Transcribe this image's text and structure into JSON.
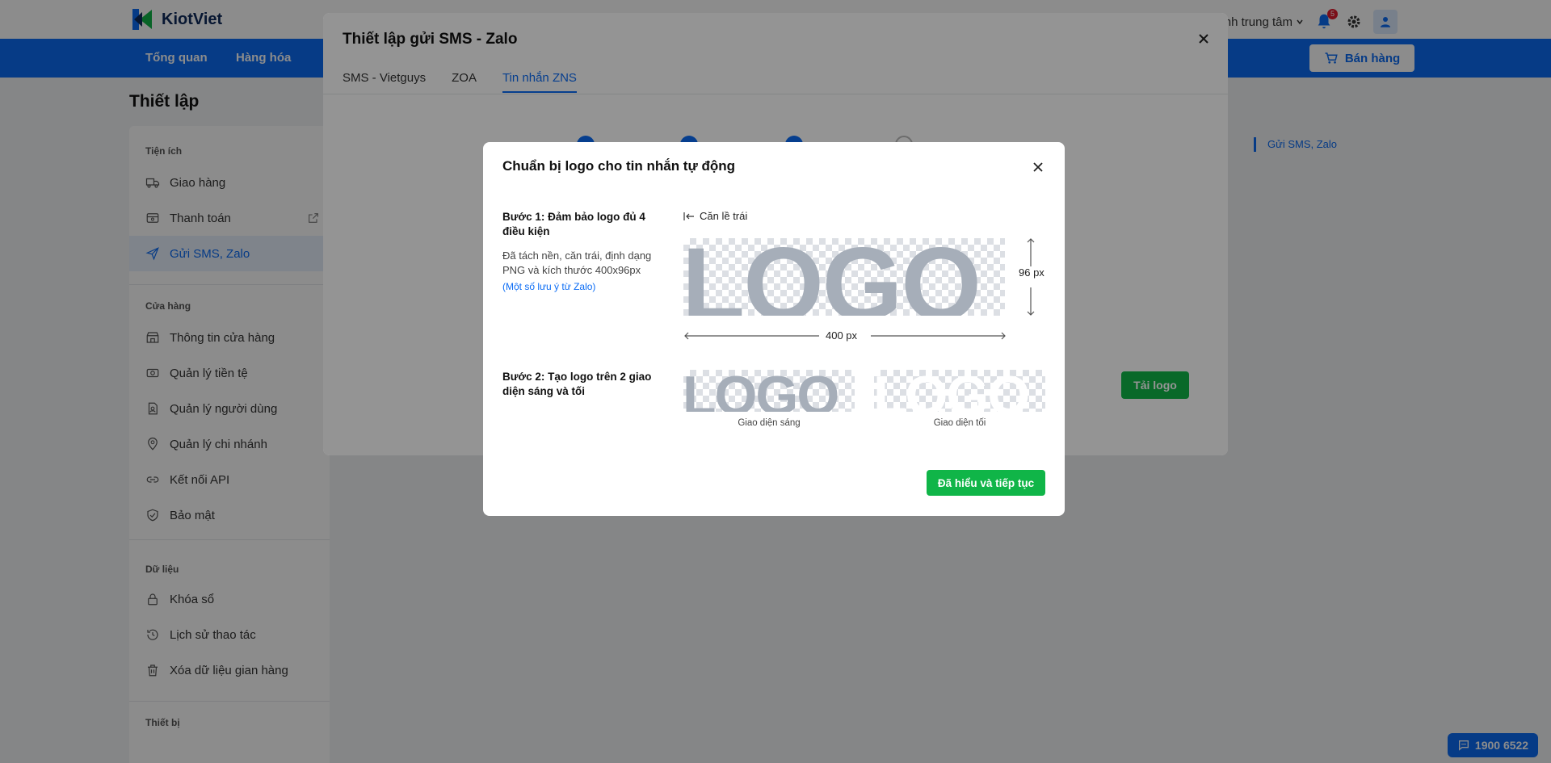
{
  "app": {
    "name": "KiotViet"
  },
  "topbar": {
    "branch_label": "hánh trung tâm",
    "notification_count": "5"
  },
  "nav": {
    "items": [
      "Tổng quan",
      "Hàng hóa"
    ],
    "sell_button": "Bán hàng"
  },
  "page": {
    "title": "Thiết lập"
  },
  "sidebar": {
    "groups": [
      {
        "label": "Tiện ích",
        "items": [
          {
            "label": "Giao hàng",
            "icon": "truck-icon"
          },
          {
            "label": "Thanh toán",
            "icon": "payment-icon"
          },
          {
            "label": "Gửi SMS, Zalo",
            "icon": "send-icon",
            "active": true
          }
        ]
      },
      {
        "label": "Cửa hàng",
        "items": [
          {
            "label": "Thông tin cửa hàng",
            "icon": "store-icon"
          },
          {
            "label": "Quản lý tiền tệ",
            "icon": "currency-icon"
          },
          {
            "label": "Quản lý người dùng",
            "icon": "user-icon"
          },
          {
            "label": "Quản lý chi nhánh",
            "icon": "location-icon"
          },
          {
            "label": "Kết nối API",
            "icon": "link-icon"
          },
          {
            "label": "Bảo mật",
            "icon": "shield-icon"
          }
        ]
      },
      {
        "label": "Dữ liệu",
        "items": [
          {
            "label": "Khóa sổ",
            "icon": "lock-icon"
          },
          {
            "label": "Lịch sử thao tác",
            "icon": "history-icon"
          },
          {
            "label": "Xóa dữ liệu gian hàng",
            "icon": "trash-icon"
          }
        ]
      },
      {
        "label": "Thiết bị",
        "items": []
      }
    ]
  },
  "right_note": "Gửi SMS, Zalo",
  "outer_modal": {
    "title": "Thiết lập gửi SMS - Zalo",
    "tabs": [
      "SMS - Vietguys",
      "ZOA",
      "Tin nhắn ZNS"
    ],
    "active_tab": 2,
    "upload_button": "Tải logo"
  },
  "inner_modal": {
    "title": "Chuẩn bị logo cho tin nhắn tự động",
    "step1_title": "Bước 1: Đảm bảo logo đủ 4 điều kiện",
    "step1_desc": "Đã tách nền, căn trái, định dạng PNG và kích thước 400x96px",
    "step1_link": "(Một số lưu ý từ Zalo)",
    "align_label": "Căn lề trái",
    "logo_text": "LOGO",
    "height_label": "96 px",
    "width_label": "400 px",
    "step2_title": "Bước 2: Tạo logo trên 2 giao diện sáng và tối",
    "light_caption": "Giao diện sáng",
    "dark_caption": "Giao diện tối",
    "continue_button": "Đã hiểu và tiếp tục"
  },
  "support": {
    "phone": "1900 6522"
  },
  "colors": {
    "primary": "#0b6cf5",
    "success": "#10b548",
    "logo_gray": "#a6aeb9"
  }
}
